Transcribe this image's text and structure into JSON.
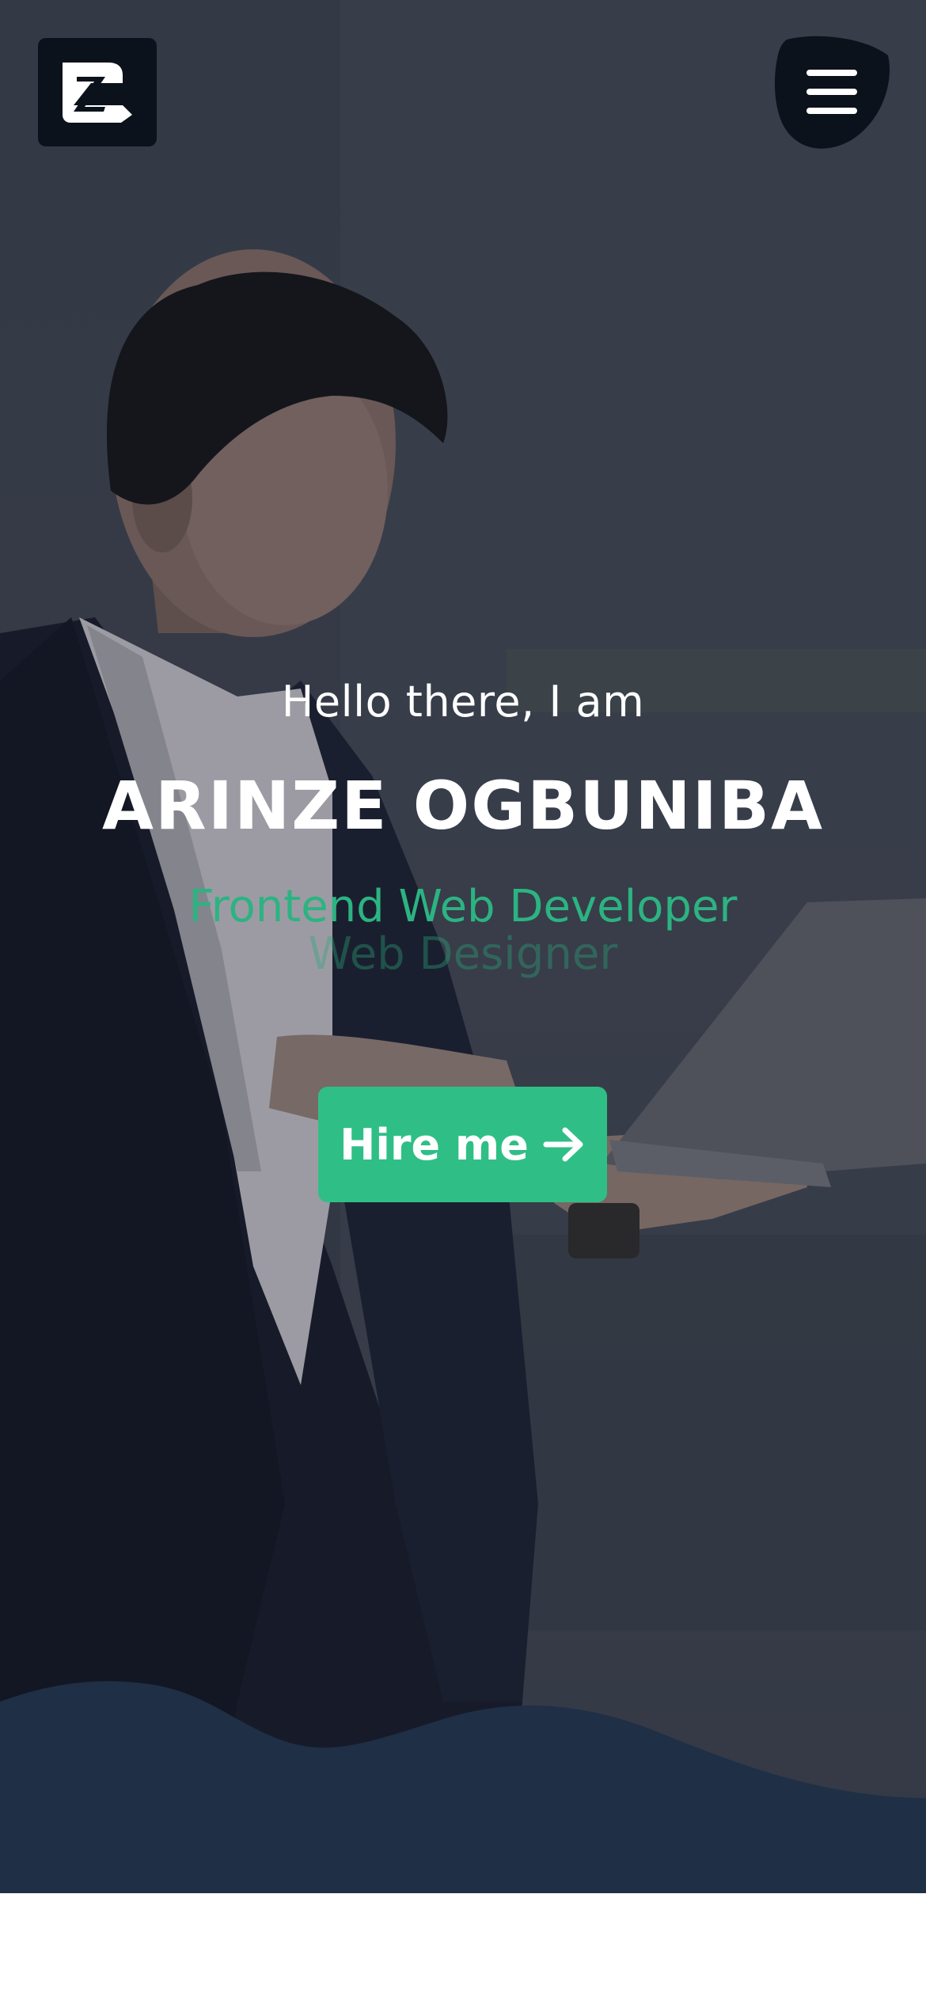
{
  "header": {
    "logo_icon": "z-logo-icon",
    "menu_icon": "hamburger-menu-icon"
  },
  "hero": {
    "greeting": "Hello there, I am",
    "name": "ARINZE OGBUNIBA",
    "roles": [
      "Frontend Web Developer",
      "Web Designer"
    ],
    "cta_label": "Hire me",
    "cta_icon": "arrow-right-icon"
  },
  "colors": {
    "accent": "#2fbf86",
    "dark": "#0c121b",
    "wave": "#1f2f45"
  }
}
